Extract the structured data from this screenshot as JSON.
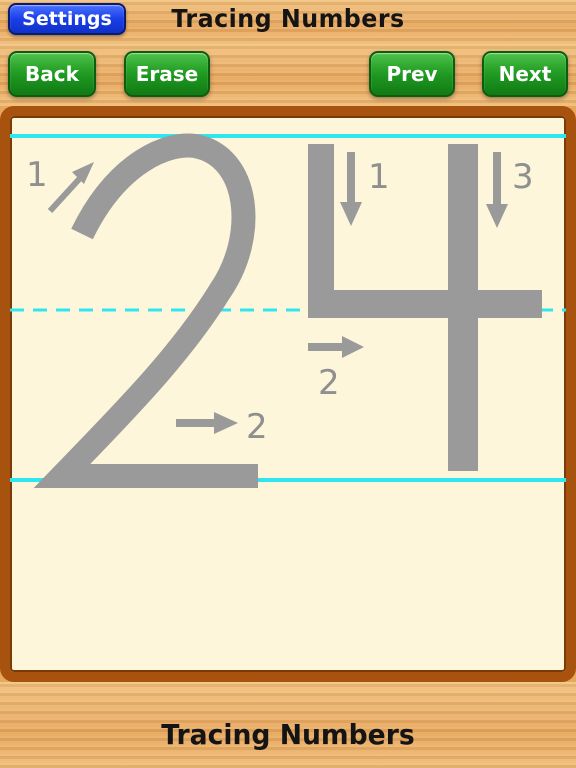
{
  "header": {
    "title": "Tracing Numbers",
    "settings_label": "Settings"
  },
  "toolbar": {
    "back_label": "Back",
    "erase_label": "Erase",
    "prev_label": "Prev",
    "next_label": "Next"
  },
  "canvas": {
    "digits": [
      "2",
      "4"
    ],
    "stroke_labels": {
      "two_stroke_1": "1",
      "two_stroke_2": "2",
      "four_stroke_1": "1",
      "four_stroke_2": "2",
      "four_stroke_3": "3"
    },
    "colors": {
      "guide_line": "#2ee6f0",
      "digit": "#9a9a9a",
      "paper": "#fdf6db",
      "frame": "#a8520f"
    }
  },
  "footer": {
    "title": "Tracing Numbers"
  }
}
